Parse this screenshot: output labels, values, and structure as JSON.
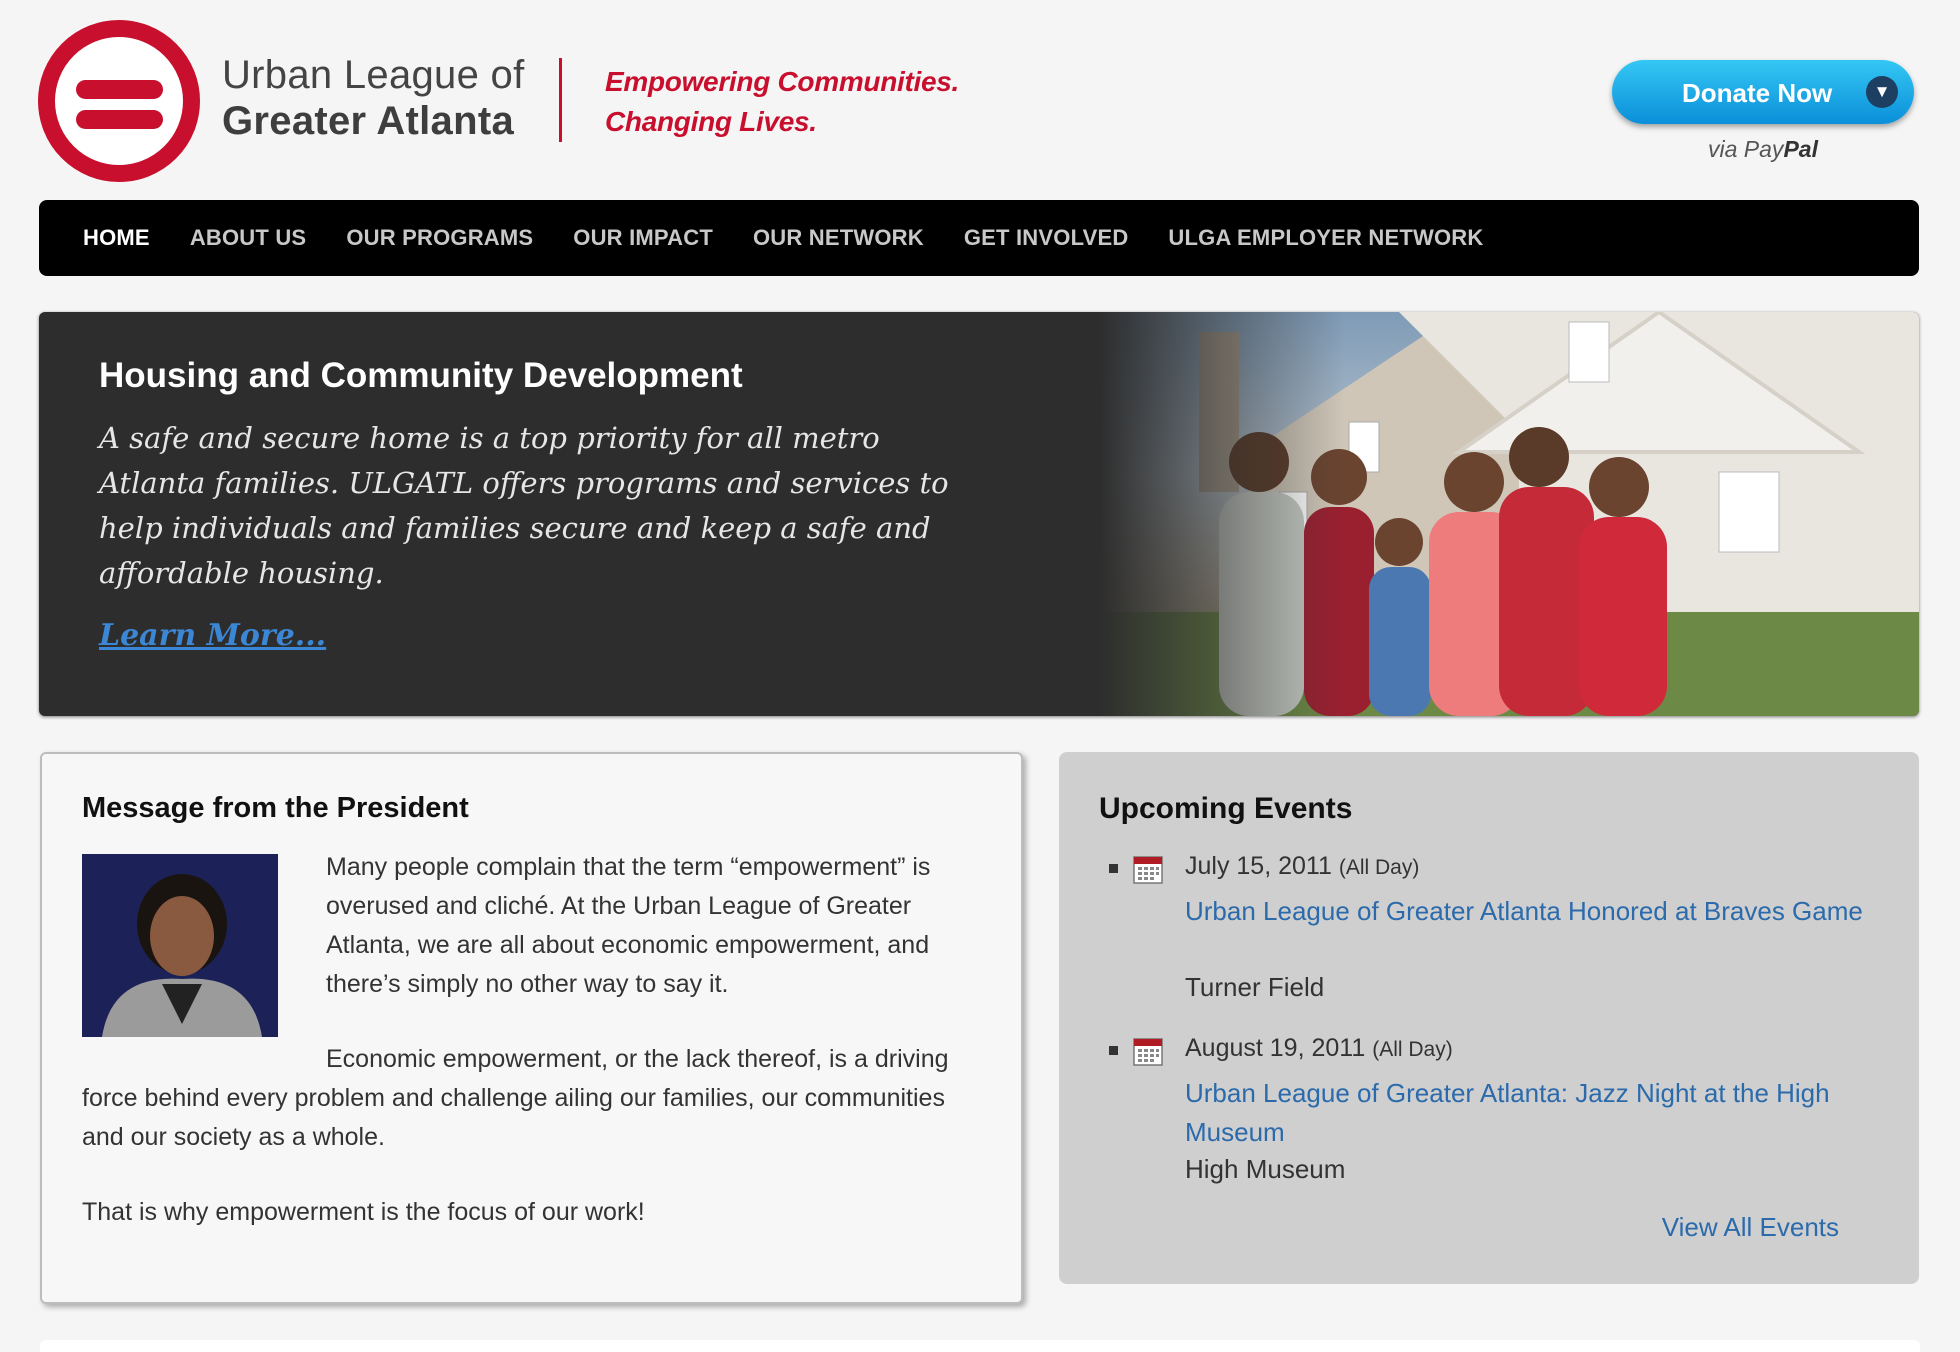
{
  "header": {
    "org_name_line1": "Urban League of",
    "org_name_line2": "Greater Atlanta",
    "tagline_line1": "Empowering Communities.",
    "tagline_line2": "Changing Lives.",
    "donate_label": "Donate Now",
    "via_text": "via Pay",
    "via_brand": "Pal",
    "brand_color": "#c8102e"
  },
  "nav": {
    "items": [
      {
        "label": "HOME",
        "active": true
      },
      {
        "label": "ABOUT US"
      },
      {
        "label": "OUR PROGRAMS"
      },
      {
        "label": "OUR IMPACT"
      },
      {
        "label": "OUR NETWORK"
      },
      {
        "label": "GET INVOLVED"
      },
      {
        "label": "ULGA EMPLOYER NETWORK"
      }
    ]
  },
  "hero": {
    "title": "Housing and Community Development",
    "text": "A safe and secure home is a top priority for all metro Atlanta families. ULGATL offers programs and services to help individuals and families secure and keep a safe and affordable housing.",
    "link": "Learn More..."
  },
  "president": {
    "title": "Message from the President",
    "para1": "Many people complain that the term “empowerment” is overused and cliché. At the Urban League of Greater Atlanta, we are all about economic empowerment, and there’s simply no other way to say it.",
    "para2_start": "Economic empowerment, or the lack thereof, is a driving",
    "para2_rest": "force behind every problem and challenge ailing our families, our communities and our society as a whole.",
    "para3": "That is why empowerment is the focus of our work!"
  },
  "events": {
    "title": "Upcoming Events",
    "items": [
      {
        "date": "July 15, 2011",
        "allday": "(All Day)",
        "title": "Urban League of Greater Atlanta Honored at Braves Game",
        "location": "Turner Field"
      },
      {
        "date": "August 19, 2011",
        "allday": "(All Day)",
        "title": "Urban League of Greater Atlanta: Jazz Night at the High Museum",
        "location": "High Museum"
      }
    ],
    "view_all": "View All Events",
    "link_color": "#2b6aab"
  }
}
